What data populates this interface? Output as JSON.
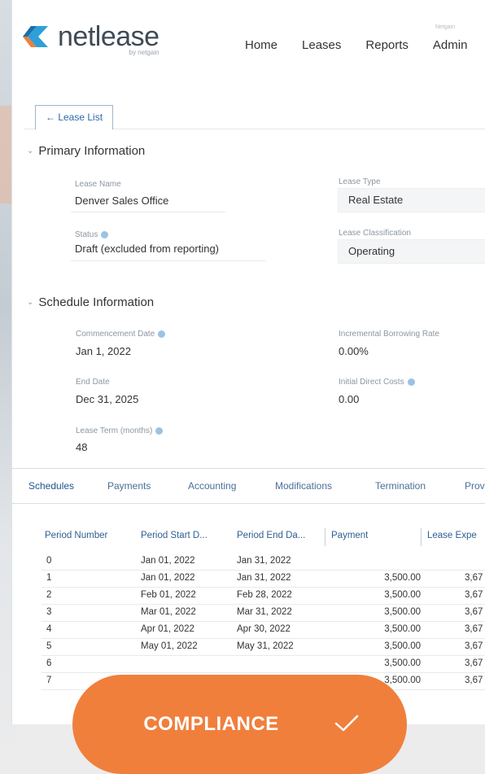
{
  "logo": {
    "name": "netlease",
    "sub": "by netgain"
  },
  "nav": {
    "items": [
      "Home",
      "Leases",
      "Reports",
      "Admin"
    ],
    "badge": "Netgain"
  },
  "back_button": "← Lease List",
  "primary": {
    "title": "Primary Information",
    "lease_name_label": "Lease Name",
    "lease_name": "Denver Sales Office",
    "lease_type_label": "Lease Type",
    "lease_type": "Real Estate",
    "status_label": "Status",
    "status": "Draft (excluded from reporting)",
    "classification_label": "Lease Classification",
    "classification": "Operating"
  },
  "schedule": {
    "title": "Schedule Information",
    "commencement_label": "Commencement Date",
    "commencement": "Jan 1, 2022",
    "ibr_label": "Incremental Borrowing Rate",
    "ibr": "0.00%",
    "end_label": "End Date",
    "end": "Dec 31, 2025",
    "idc_label": "Initial Direct Costs",
    "idc": "0.00",
    "term_label": "Lease Term (months)",
    "term": "48"
  },
  "tabs": [
    "Schedules",
    "Payments",
    "Accounting",
    "Modifications",
    "Termination",
    "Prov"
  ],
  "table": {
    "headers": [
      "Period Number",
      "Period Start D...",
      "Period End Da...",
      "Payment",
      "Lease Expe"
    ],
    "rows": [
      {
        "period": "0",
        "start": "Jan 01, 2022",
        "end": "Jan 31, 2022",
        "payment": "",
        "expense": ""
      },
      {
        "period": "1",
        "start": "Jan 01, 2022",
        "end": "Jan 31, 2022",
        "payment": "3,500.00",
        "expense": "3,67"
      },
      {
        "period": "2",
        "start": "Feb 01, 2022",
        "end": "Feb 28, 2022",
        "payment": "3,500.00",
        "expense": "3,67"
      },
      {
        "period": "3",
        "start": "Mar 01, 2022",
        "end": "Mar 31, 2022",
        "payment": "3,500.00",
        "expense": "3,67"
      },
      {
        "period": "4",
        "start": "Apr 01, 2022",
        "end": "Apr 30, 2022",
        "payment": "3,500.00",
        "expense": "3,67"
      },
      {
        "period": "5",
        "start": "May 01, 2022",
        "end": "May 31, 2022",
        "payment": "3,500.00",
        "expense": "3,67"
      },
      {
        "period": "6",
        "start": "",
        "end": "",
        "payment": "3,500.00",
        "expense": "3,67"
      },
      {
        "period": "7",
        "start": "",
        "end": "",
        "payment": "3,500.00",
        "expense": "3,67"
      }
    ]
  },
  "compliance": {
    "label": "COMPLIANCE",
    "color": "#f07f3c"
  }
}
